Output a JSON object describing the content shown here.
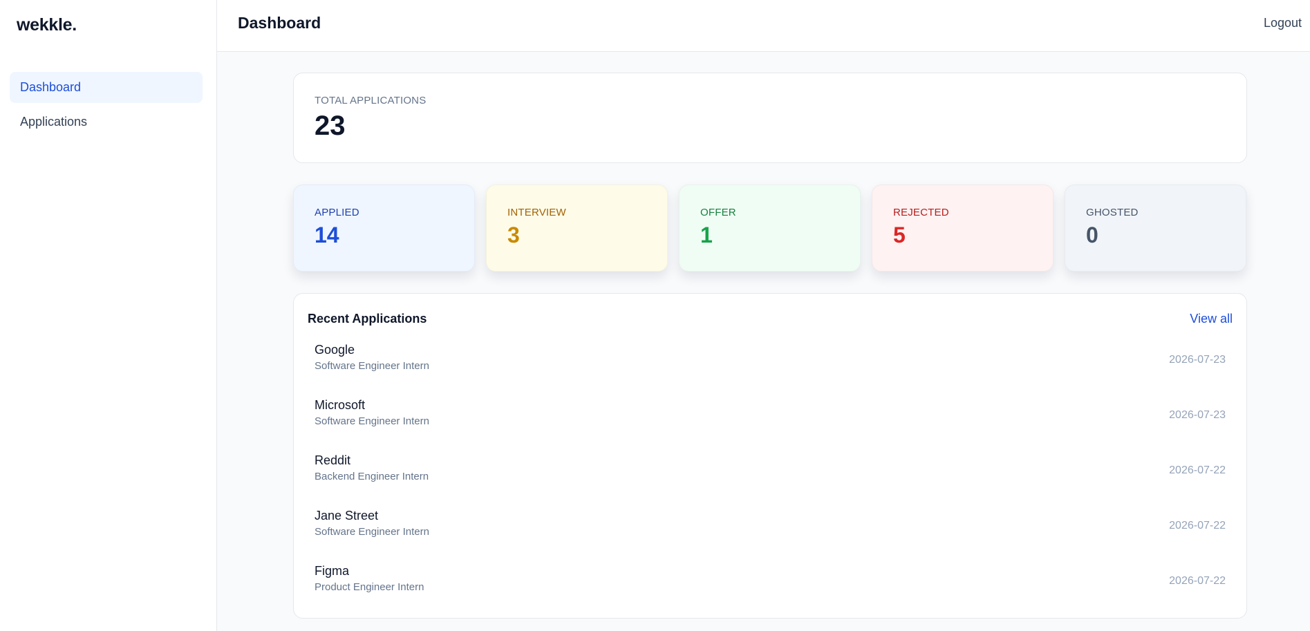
{
  "brand": "wekkle.",
  "sidebar": {
    "items": [
      {
        "label": "Dashboard",
        "active": true
      },
      {
        "label": "Applications",
        "active": false
      }
    ]
  },
  "header": {
    "title": "Dashboard",
    "logout_label": "Logout"
  },
  "summary": {
    "total_label": "TOTAL APPLICATIONS",
    "total_value": "23"
  },
  "stats": [
    {
      "label": "APPLIED",
      "value": "14",
      "bg": "#eff6ff",
      "color": "#1d4ed8",
      "label_color": "#1e40af"
    },
    {
      "label": "INTERVIEW",
      "value": "3",
      "bg": "#fefce8",
      "color": "#ca8a04",
      "label_color": "#a16207"
    },
    {
      "label": "OFFER",
      "value": "1",
      "bg": "#f0fdf4",
      "color": "#16a34a",
      "label_color": "#15803d"
    },
    {
      "label": "REJECTED",
      "value": "5",
      "bg": "#fef2f2",
      "color": "#dc2626",
      "label_color": "#b91c1c"
    },
    {
      "label": "GHOSTED",
      "value": "0",
      "bg": "#f1f5f9",
      "color": "#475569",
      "label_color": "#475569"
    }
  ],
  "recent": {
    "title": "Recent Applications",
    "view_all_label": "View all",
    "rows": [
      {
        "company": "Google",
        "role": "Software Engineer Intern",
        "date": "2026-07-23"
      },
      {
        "company": "Microsoft",
        "role": "Software Engineer Intern",
        "date": "2026-07-23"
      },
      {
        "company": "Reddit",
        "role": "Backend Engineer Intern",
        "date": "2026-07-22"
      },
      {
        "company": "Jane Street",
        "role": "Software Engineer Intern",
        "date": "2026-07-22"
      },
      {
        "company": "Figma",
        "role": "Product Engineer Intern",
        "date": "2026-07-22"
      }
    ]
  }
}
